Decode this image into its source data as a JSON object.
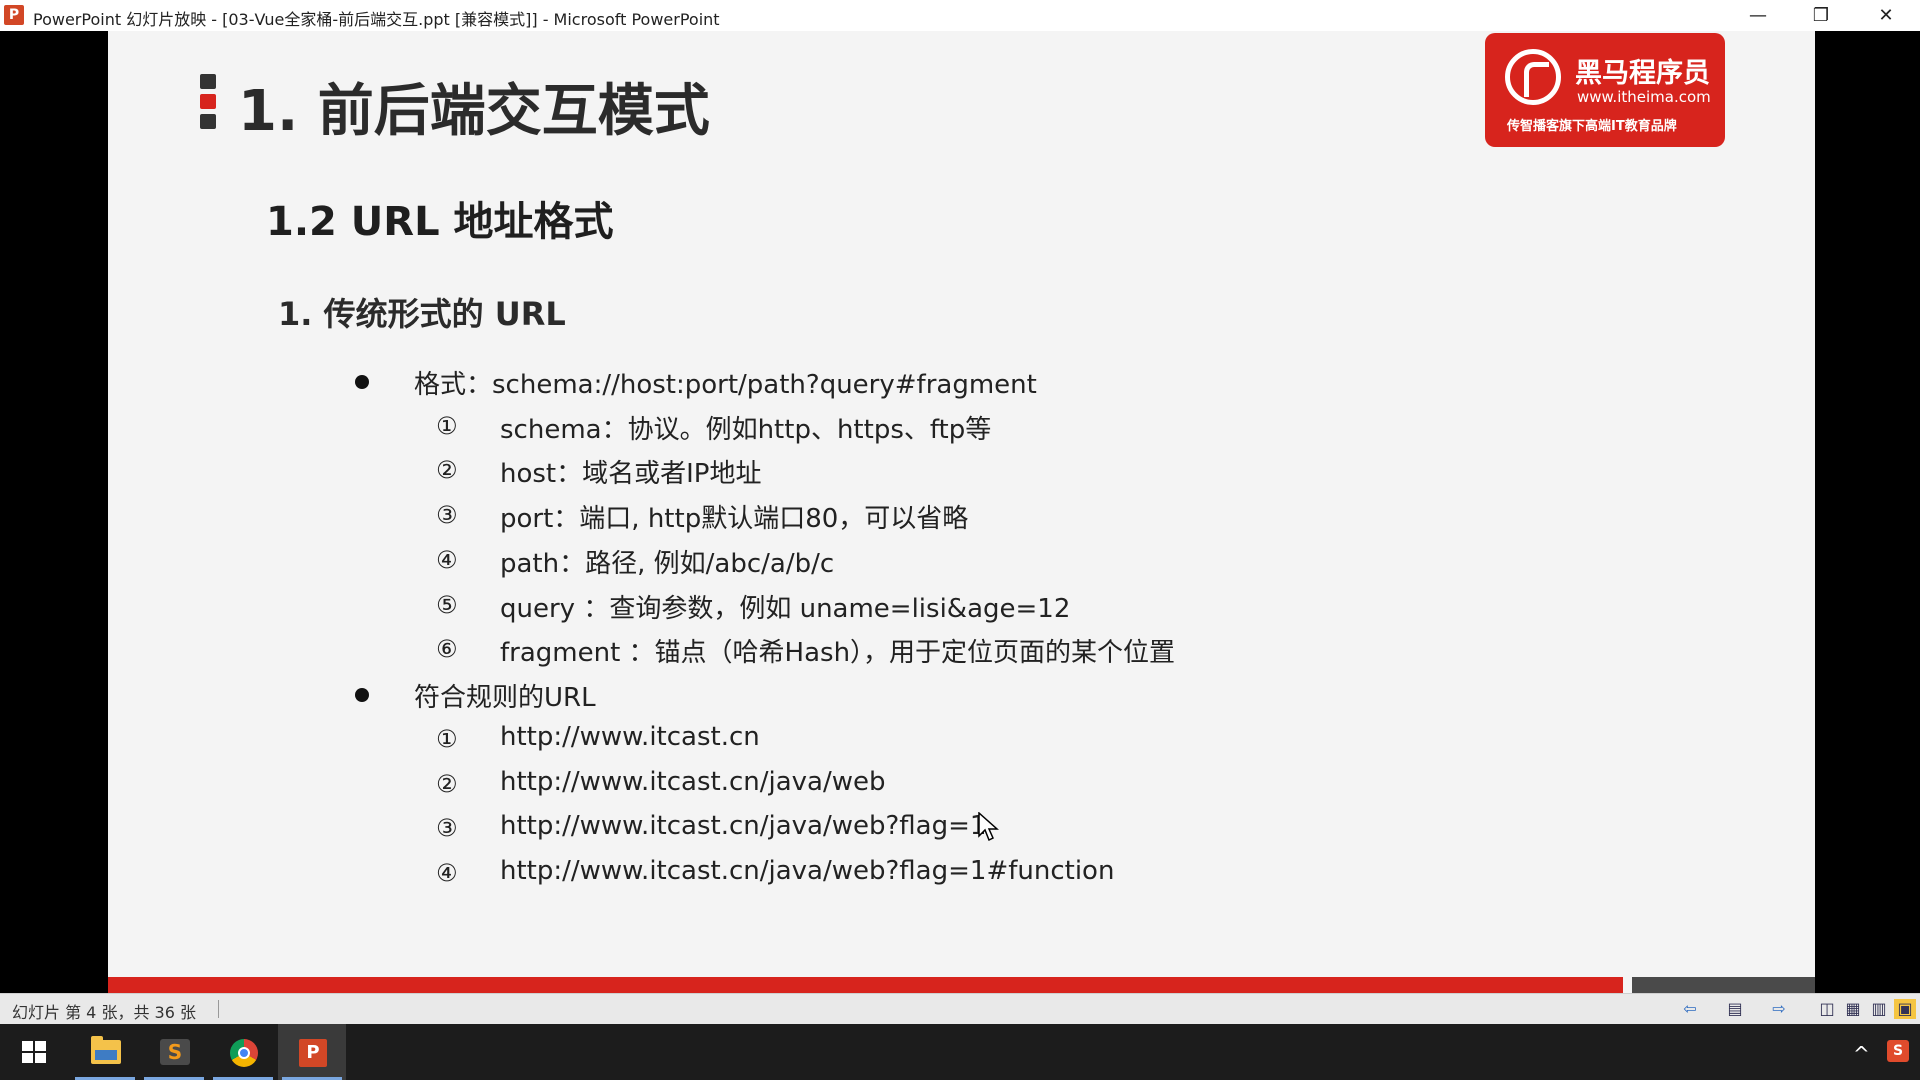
{
  "window": {
    "app_icon": "P",
    "title": "PowerPoint 幻灯片放映 - [03-Vue全家桶-前后端交互.ppt [兼容模式]] - Microsoft PowerPoint",
    "controls": {
      "minimize": "—",
      "restore": "❐",
      "close": "✕"
    }
  },
  "slide": {
    "title": "1. 前后端交互模式",
    "subtitle": "1.2 URL 地址格式",
    "section": "1. 传统形式的 URL",
    "bullets": [
      {
        "text": "格式：schema://host:port/path?query#fragment",
        "items": [
          {
            "num": "①",
            "text": "schema：协议。例如http、https、ftp等"
          },
          {
            "num": "②",
            "text": "host：域名或者IP地址"
          },
          {
            "num": "③",
            "text": "port：端口, http默认端口80，可以省略"
          },
          {
            "num": "④",
            "text": "path：路径, 例如/abc/a/b/c"
          },
          {
            "num": "⑤",
            "text": "query ：查询参数，例如 uname=lisi&age=12"
          },
          {
            "num": "⑥",
            "text": "fragment ：锚点（哈希Hash），用于定位页面的某个位置"
          }
        ]
      },
      {
        "text": "符合规则的URL",
        "items": [
          {
            "num": "①",
            "text": "http://www.itcast.cn"
          },
          {
            "num": "②",
            "text": "http://www.itcast.cn/java/web"
          },
          {
            "num": "③",
            "text": "http://www.itcast.cn/java/web?flag=1"
          },
          {
            "num": "④",
            "text": "http://www.itcast.cn/java/web?flag=1#function"
          }
        ]
      }
    ],
    "logo": {
      "brand": "黑马程序员",
      "url": "www.itheima.com",
      "tagline": "传智播客旗下高端IT教育品牌"
    },
    "accent_color": "#d7241d"
  },
  "statusbar": {
    "slide_info": "幻灯片 第 4 张，共 36 张",
    "icons": [
      "back-arrow-icon",
      "notes-icon",
      "forward-arrow-icon",
      "normal-view-icon",
      "slide-sorter-icon",
      "reading-view-icon",
      "slideshow-icon"
    ]
  },
  "taskbar": {
    "items": [
      "windows-start-icon",
      "file-explorer-icon",
      "sublime-text-icon",
      "chrome-icon",
      "powerpoint-icon"
    ],
    "tray": {
      "chevron": "^",
      "s_label": "S"
    }
  }
}
